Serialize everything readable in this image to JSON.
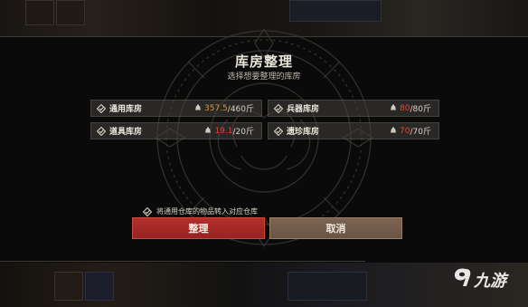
{
  "dialog": {
    "title": "库房整理",
    "subtitle": "选择想要整理的库房"
  },
  "warehouses": [
    {
      "name": "通用库房",
      "current": "357.5",
      "capacity": "/460斤",
      "status": "orange",
      "checked": true
    },
    {
      "name": "兵器库房",
      "current": "80",
      "capacity": "/80斤",
      "status": "red",
      "checked": true
    },
    {
      "name": "道具库房",
      "current": "19.1",
      "capacity": "/20斤",
      "status": "red",
      "checked": true
    },
    {
      "name": "遗珍库房",
      "current": "70",
      "capacity": "/70斤",
      "status": "red",
      "checked": true
    }
  ],
  "transfer_option": {
    "label": "将通用仓库的物品转入对应仓库",
    "checked": true
  },
  "buttons": {
    "confirm": "整理",
    "cancel": "取消"
  },
  "watermark": {
    "text": "九游"
  },
  "colors": {
    "confirm_bg": "#a82a27",
    "cancel_bg": "#735b4a",
    "value_orange": "#d59a3c",
    "value_red": "#d84a3a"
  },
  "icons": {
    "checkbox": "check-diamond-icon",
    "weight": "weight-bag-icon",
    "watermark_logo": "nine-game-logo-icon"
  }
}
